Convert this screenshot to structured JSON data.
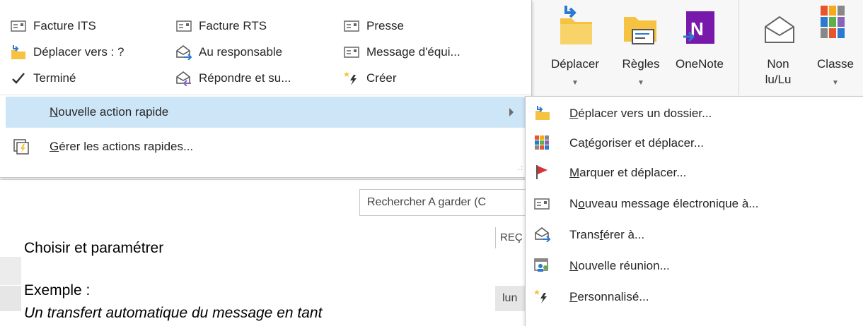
{
  "quick_steps_gallery": {
    "items": [
      {
        "label": "Facture ITS",
        "icon": "envelope-icon"
      },
      {
        "label": "Facture RTS",
        "icon": "envelope-icon"
      },
      {
        "label": "Presse",
        "icon": "envelope-icon"
      },
      {
        "label": "Déplacer vers : ?",
        "icon": "folder-move-icon"
      },
      {
        "label": "Au responsable",
        "icon": "forward-icon"
      },
      {
        "label": "Message d'équi...",
        "icon": "envelope-icon"
      },
      {
        "label": "Terminé",
        "icon": "checkmark-icon"
      },
      {
        "label": "Répondre et su...",
        "icon": "reply-delete-icon"
      },
      {
        "label": "Créer",
        "icon": "lightning-icon"
      }
    ],
    "new_quick_step": {
      "label_prefix": "",
      "underlined_char": "N",
      "label_rest": "ouvelle action rapide"
    },
    "manage_quick_steps": {
      "underlined_char": "G",
      "label_rest": "érer les actions rapides..."
    }
  },
  "submenu": {
    "items": [
      {
        "pre": "",
        "ul": "D",
        "post": "éplacer vers un dossier...",
        "icon": "folder-move-icon"
      },
      {
        "pre": "Ca",
        "ul": "t",
        "post": "égoriser et déplacer...",
        "icon": "categorize-icon"
      },
      {
        "pre": "",
        "ul": "M",
        "post": "arquer et déplacer...",
        "icon": "flag-icon"
      },
      {
        "pre": "N",
        "ul": "o",
        "post": "uveau message électronique à...",
        "icon": "envelope-icon"
      },
      {
        "pre": "Trans",
        "ul": "f",
        "post": "érer à...",
        "icon": "forward-icon"
      },
      {
        "pre": "",
        "ul": "N",
        "post": "ouvelle réunion...",
        "icon": "meeting-icon"
      },
      {
        "pre": "",
        "ul": "P",
        "post": "ersonnalisé...",
        "icon": "lightning-icon"
      }
    ]
  },
  "ribbon": {
    "move": "Déplacer",
    "rules": "Règles",
    "onenote": "OneNote",
    "unread_line1": "Non",
    "unread_line2": "lu/Lu",
    "categorize": "Classe"
  },
  "search": {
    "text": "Rechercher A garder (C"
  },
  "message_list": {
    "header": "REÇ",
    "cell": "lun"
  },
  "document": {
    "line1": "Choisir et paramétrer",
    "line2": "Exemple :",
    "line3": "Un transfert automatique du message en tant"
  },
  "colors": {
    "highlight": "#cde6f7",
    "folder": "#f5c242",
    "flag": "#d13438",
    "onenote": "#7719aa",
    "arrow_blue": "#2b79d0"
  }
}
